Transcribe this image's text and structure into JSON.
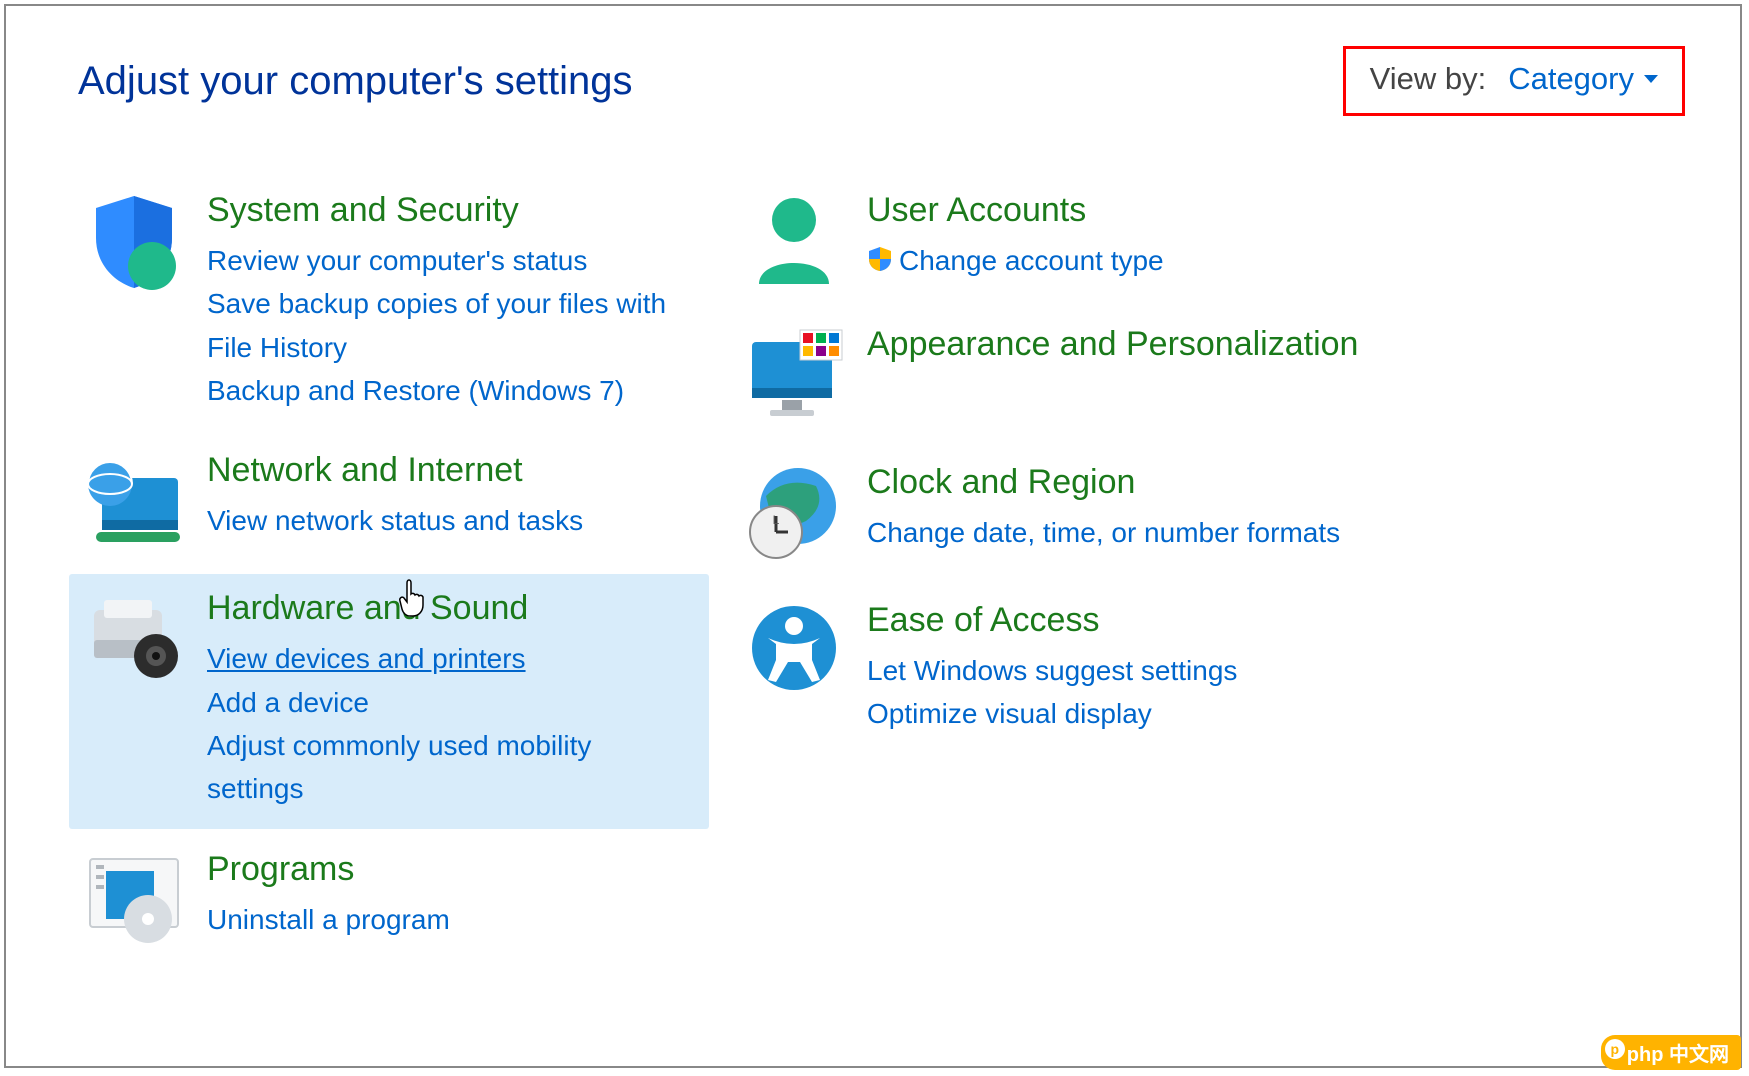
{
  "header": {
    "title": "Adjust your computer's settings",
    "viewby_label": "View by:",
    "viewby_value": "Category"
  },
  "left": {
    "system": {
      "title": "System and Security",
      "links": [
        "Review your computer's status",
        "Save backup copies of your files with File History",
        "Backup and Restore (Windows 7)"
      ]
    },
    "network": {
      "title": "Network and Internet",
      "links": [
        "View network status and tasks"
      ]
    },
    "hardware": {
      "title": "Hardware and Sound",
      "links": [
        "View devices and printers",
        "Add a device",
        "Adjust commonly used mobility settings"
      ]
    },
    "programs": {
      "title": "Programs",
      "links": [
        "Uninstall a program"
      ]
    }
  },
  "right": {
    "user": {
      "title": "User Accounts",
      "links": [
        "Change account type"
      ]
    },
    "appearance": {
      "title": "Appearance and Personalization"
    },
    "clock": {
      "title": "Clock and Region",
      "links": [
        "Change date, time, or number formats"
      ]
    },
    "ease": {
      "title": "Ease of Access",
      "links": [
        "Let Windows suggest settings",
        "Optimize visual display"
      ]
    }
  },
  "watermark": "中文网"
}
